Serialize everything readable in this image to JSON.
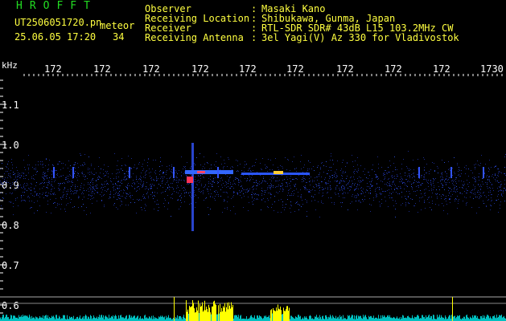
{
  "header": {
    "brand": "HROFFT",
    "filename": "UT2506051720.pn",
    "mode": "meteor",
    "timestamp": "25.06.05 17:20",
    "count": "34",
    "fields": [
      {
        "label": "Observer",
        "value": "Masaki Kano"
      },
      {
        "label": "Receiving Location",
        "value": "Shibukawa, Gunma, Japan"
      },
      {
        "label": "Receiver",
        "value": "RTL-SDR SDR# 43dB L15 103.2MHz CW"
      },
      {
        "label": "Receiving Antenna",
        "value": "3el Yagi(V) Az 330 for Vladivostok"
      }
    ]
  },
  "axes": {
    "y_unit": "kHz",
    "y_ticks": [
      "1.1",
      "1.0",
      "0.9",
      "0.8",
      "0.7",
      "0.6"
    ],
    "x_ticks": [
      "172",
      "172",
      "172",
      "172",
      "172",
      "172",
      "172",
      "172",
      "172",
      "1730"
    ]
  },
  "colors": {
    "background": "#000000",
    "header_text": "#ffff40",
    "brand": "#22dd22",
    "signal": "#3355ff",
    "spectrum": "#ffff00"
  }
}
